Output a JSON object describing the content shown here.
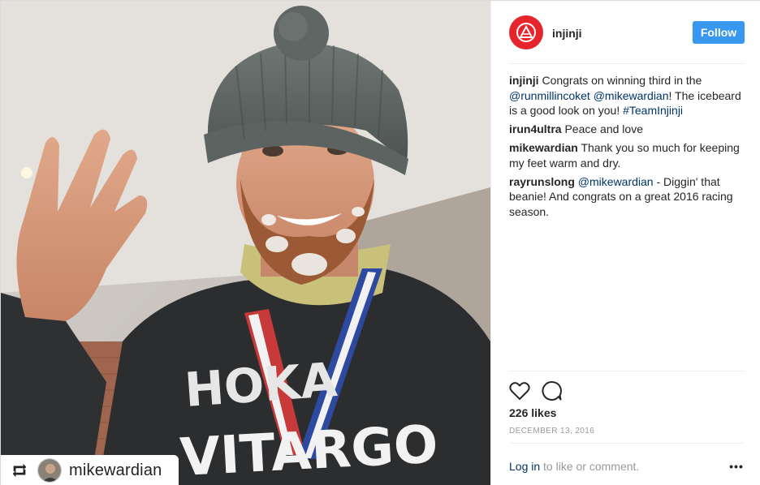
{
  "post": {
    "account": {
      "username": "injinji",
      "avatar_icon": "injinji-logo-icon",
      "avatar_color": "#e5242b"
    },
    "follow_label": "Follow",
    "follow_color": "#3897f0",
    "repost": {
      "icon": "repost-icon",
      "username": "mikewardian"
    },
    "comments": [
      {
        "author": "injinji",
        "parts": [
          {
            "text": " Congrats on winning third in the ",
            "type": "text"
          },
          {
            "text": "@runmillincoket",
            "type": "mention"
          },
          {
            "text": " ",
            "type": "text"
          },
          {
            "text": "@mikewardian",
            "type": "mention"
          },
          {
            "text": "! The icebeard is a good look on you! ",
            "type": "text"
          },
          {
            "text": "#TeamInjinji",
            "type": "mention"
          }
        ]
      },
      {
        "author": "irun4ultra",
        "parts": [
          {
            "text": " Peace and love",
            "type": "text"
          }
        ]
      },
      {
        "author": "mikewardian",
        "parts": [
          {
            "text": " Thank you so much for keeping my feet warm and dry.",
            "type": "text"
          }
        ]
      },
      {
        "author": "rayrunslong",
        "parts": [
          {
            "text": " ",
            "type": "text"
          },
          {
            "text": "@mikewardian",
            "type": "mention"
          },
          {
            "text": " - Diggin' that beanie! And congrats on a great 2016 racing season.",
            "type": "text"
          }
        ]
      }
    ],
    "actions": {
      "like_icon": "heart-icon",
      "comment_icon": "comment-bubble-icon"
    },
    "likes_label": "226 likes",
    "date": "DECEMBER 13, 2016",
    "login": {
      "link_label": "Log in",
      "suffix": " to like or comment."
    },
    "more_label": "•••",
    "colors": {
      "mention": "#003569",
      "muted": "#999999"
    }
  }
}
